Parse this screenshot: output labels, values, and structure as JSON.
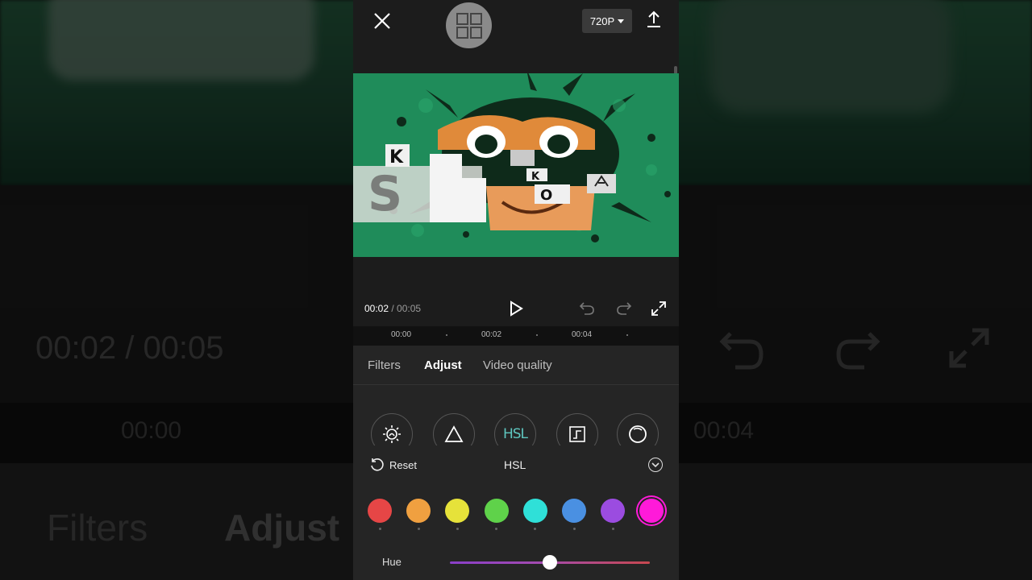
{
  "topbar": {
    "resolution": "720P"
  },
  "player": {
    "current_time": "00:02",
    "duration": "/ 00:05"
  },
  "timeline": {
    "ticks": [
      "00:00",
      "00:02",
      "00:04"
    ]
  },
  "tabs": [
    {
      "label": "Filters",
      "active": false
    },
    {
      "label": "Adjust",
      "active": true
    },
    {
      "label": "Video quality",
      "active": false
    }
  ],
  "tools": [
    {
      "name": "brightness",
      "icon": "sun-icon"
    },
    {
      "name": "sharpen",
      "icon": "triangle-icon"
    },
    {
      "name": "hsl",
      "label": "HSL"
    },
    {
      "name": "curves",
      "icon": "curve-icon"
    },
    {
      "name": "vignette",
      "icon": "circle-icon"
    }
  ],
  "hsl": {
    "reset_label": "Reset",
    "title": "HSL"
  },
  "swatches": [
    {
      "color": "#e64646",
      "selected": false
    },
    {
      "color": "#f0a040",
      "selected": false
    },
    {
      "color": "#e6e23a",
      "selected": false
    },
    {
      "color": "#5fd24a",
      "selected": false
    },
    {
      "color": "#2fe0d8",
      "selected": false
    },
    {
      "color": "#4a90e2",
      "selected": false
    },
    {
      "color": "#9b4ce0",
      "selected": false
    },
    {
      "color": "#ff1ad9",
      "selected": true
    }
  ],
  "slider": {
    "label": "Hue",
    "value_fraction": 0.5
  },
  "background": {
    "time": "00:02 / 00:05",
    "ruler_left": "00:00",
    "ruler_right": "00:04",
    "tab_filters": "Filters",
    "tab_adjust": "Adjust"
  }
}
